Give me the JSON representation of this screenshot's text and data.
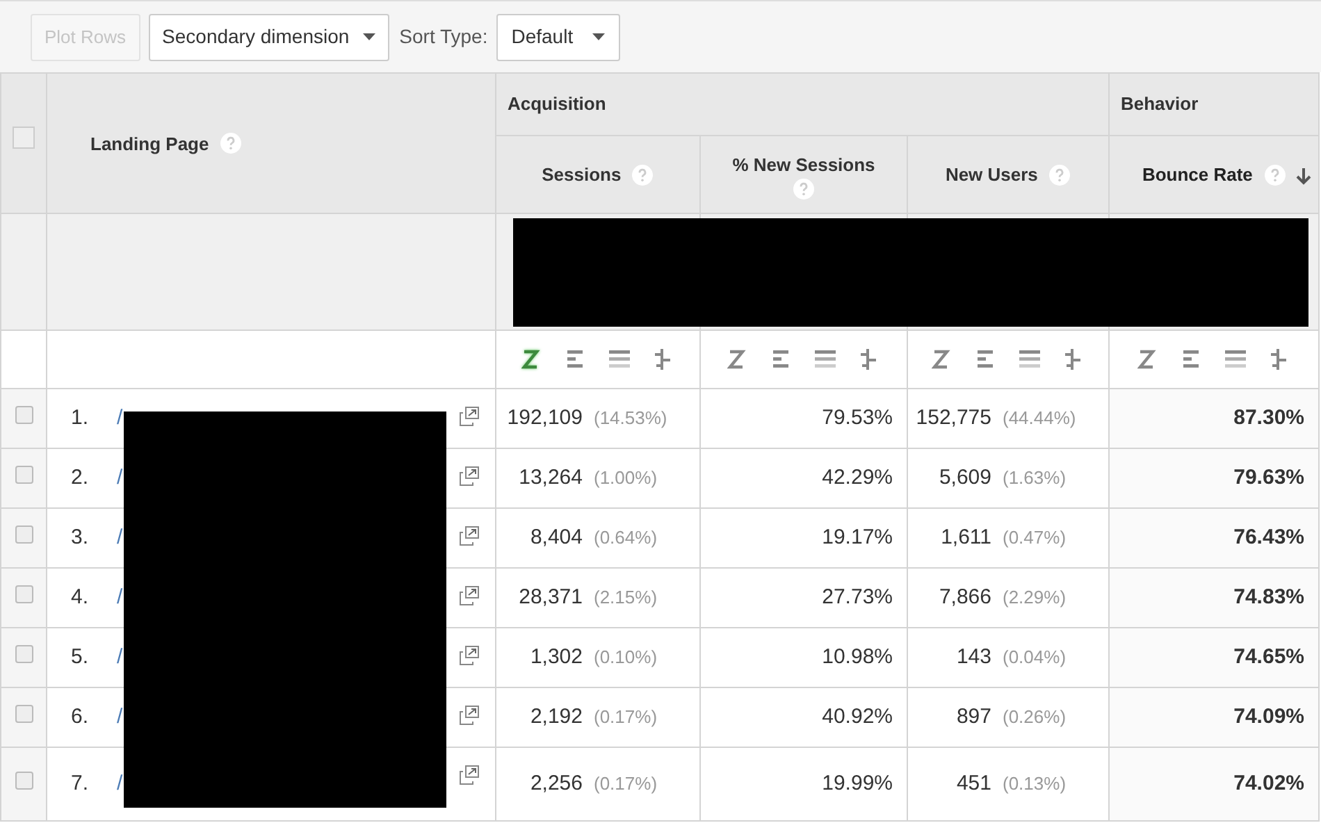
{
  "toolbar": {
    "plot_rows": {
      "label": "Plot Rows",
      "disabled": true
    },
    "secondary_dimension": {
      "label": "Secondary dimension"
    },
    "sort_type": {
      "label": "Sort Type:",
      "value": "Default"
    }
  },
  "table": {
    "select_all": {
      "checked": false
    },
    "dimension": {
      "label": "Landing Page"
    },
    "groups": [
      {
        "label": "Acquisition"
      },
      {
        "label": "Behavior"
      }
    ],
    "columns": [
      {
        "label": "Sessions",
        "sorted": false,
        "view_icons": [
          {
            "selected": true
          },
          {
            "selected": false
          },
          {
            "selected": false
          },
          {
            "selected": false
          }
        ]
      },
      {
        "label": "% New Sessions",
        "sorted": false,
        "view_icons": [
          {
            "selected": false
          },
          {
            "selected": false
          },
          {
            "selected": false
          },
          {
            "selected": false
          }
        ]
      },
      {
        "label": "New Users",
        "sorted": false,
        "view_icons": [
          {
            "selected": false
          },
          {
            "selected": false
          },
          {
            "selected": false
          },
          {
            "selected": false
          }
        ]
      },
      {
        "label": "Bounce Rate",
        "sorted": true,
        "view_icons": [
          {
            "selected": false
          },
          {
            "selected": false
          },
          {
            "selected": false
          },
          {
            "selected": false
          }
        ]
      }
    ],
    "rows": [
      {
        "checked": false,
        "index": "1.",
        "page": "/",
        "sessions": "192,109",
        "sessions_share": "(14.53%)",
        "new_sessions": "79.53%",
        "new_users": "152,775",
        "new_users_share": "(44.44%)",
        "bounce_rate": "87.30%"
      },
      {
        "checked": false,
        "index": "2.",
        "page": "/",
        "sessions": "13,264",
        "sessions_share": "(1.00%)",
        "new_sessions": "42.29%",
        "new_users": "5,609",
        "new_users_share": "(1.63%)",
        "bounce_rate": "79.63%"
      },
      {
        "checked": false,
        "index": "3.",
        "page": "/",
        "sessions": "8,404",
        "sessions_share": "(0.64%)",
        "new_sessions": "19.17%",
        "new_users": "1,611",
        "new_users_share": "(0.47%)",
        "bounce_rate": "76.43%"
      },
      {
        "checked": false,
        "index": "4.",
        "page": "/",
        "sessions": "28,371",
        "sessions_share": "(2.15%)",
        "new_sessions": "27.73%",
        "new_users": "7,866",
        "new_users_share": "(2.29%)",
        "bounce_rate": "74.83%"
      },
      {
        "checked": false,
        "index": "5.",
        "page": "/",
        "sessions": "1,302",
        "sessions_share": "(0.10%)",
        "new_sessions": "10.98%",
        "new_users": "143",
        "new_users_share": "(0.04%)",
        "bounce_rate": "74.65%"
      },
      {
        "checked": false,
        "index": "6.",
        "page": "/",
        "sessions": "2,192",
        "sessions_share": "(0.17%)",
        "new_sessions": "40.92%",
        "new_users": "897",
        "new_users_share": "(0.26%)",
        "bounce_rate": "74.09%"
      },
      {
        "checked": false,
        "index": "7.",
        "page": "/",
        "sessions": "2,256",
        "sessions_share": "(0.17%)",
        "new_sessions": "19.99%",
        "new_users": "451",
        "new_users_share": "(0.13%)",
        "bounce_rate": "74.02%"
      }
    ]
  }
}
